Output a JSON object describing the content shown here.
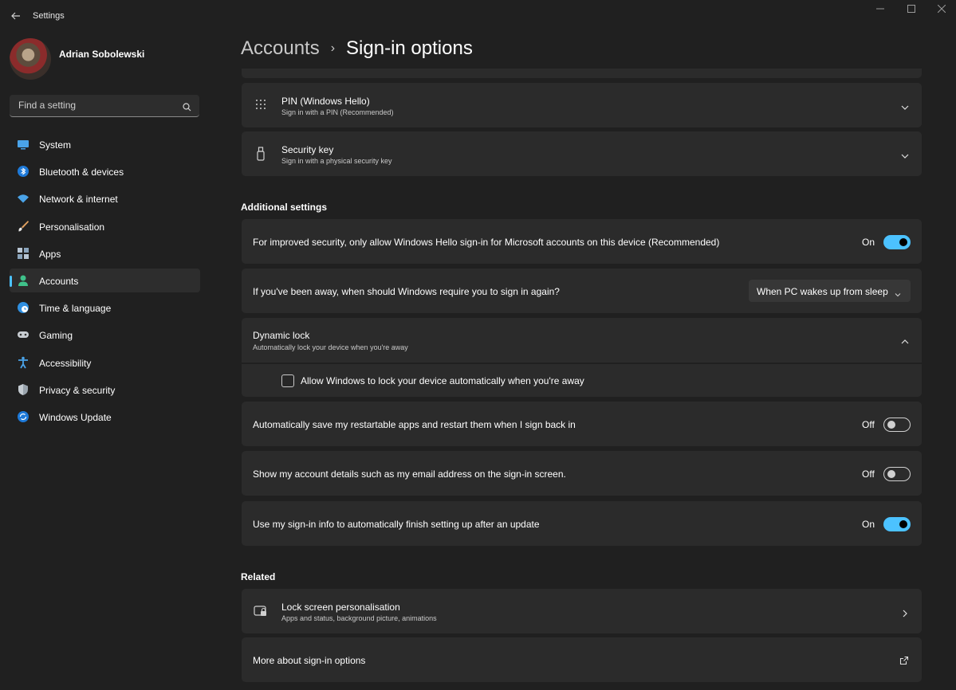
{
  "window": {
    "app_title": "Settings"
  },
  "profile": {
    "name": "Adrian Sobolewski"
  },
  "search": {
    "placeholder": "Find a setting"
  },
  "sidebar": {
    "items": [
      {
        "label": "System",
        "icon": "monitor-icon"
      },
      {
        "label": "Bluetooth & devices",
        "icon": "bluetooth-icon"
      },
      {
        "label": "Network & internet",
        "icon": "wifi-icon"
      },
      {
        "label": "Personalisation",
        "icon": "brush-icon"
      },
      {
        "label": "Apps",
        "icon": "apps-icon"
      },
      {
        "label": "Accounts",
        "icon": "person-icon",
        "selected": true
      },
      {
        "label": "Time & language",
        "icon": "globe-clock-icon"
      },
      {
        "label": "Gaming",
        "icon": "gamepad-icon"
      },
      {
        "label": "Accessibility",
        "icon": "accessibility-icon"
      },
      {
        "label": "Privacy & security",
        "icon": "shield-icon"
      },
      {
        "label": "Windows Update",
        "icon": "update-icon"
      }
    ]
  },
  "breadcrumb": {
    "parent": "Accounts",
    "separator": "›",
    "current": "Sign-in options"
  },
  "sign_in_methods": [
    {
      "title": "PIN (Windows Hello)",
      "subtitle": "Sign in with a PIN (Recommended)",
      "icon": "keypad-icon"
    },
    {
      "title": "Security key",
      "subtitle": "Sign in with a physical security key",
      "icon": "usb-key-icon"
    }
  ],
  "additional": {
    "heading": "Additional settings",
    "hello_only": {
      "label": "For improved security, only allow Windows Hello sign-in for Microsoft accounts on this device (Recommended)",
      "state": "On"
    },
    "away": {
      "label": "If you've been away, when should Windows require you to sign in again?",
      "value": "When PC wakes up from sleep"
    },
    "dynamic_lock": {
      "title": "Dynamic lock",
      "subtitle": "Automatically lock your device when you're away",
      "checkbox_label": "Allow Windows to lock your device automatically when you're away",
      "checked": false
    },
    "restart_apps": {
      "label": "Automatically save my restartable apps and restart them when I sign back in",
      "state": "Off"
    },
    "show_account": {
      "label": "Show my account details such as my email address on the sign-in screen.",
      "state": "Off"
    },
    "use_signin_info": {
      "label": "Use my sign-in info to automatically finish setting up after an update",
      "state": "On"
    }
  },
  "related": {
    "heading": "Related",
    "lock_screen": {
      "title": "Lock screen personalisation",
      "subtitle": "Apps and status, background picture, animations"
    },
    "more": {
      "label": "More about sign-in options"
    }
  },
  "colors": {
    "accent": "#4cc2ff",
    "background": "#202020",
    "card": "#2b2b2b"
  }
}
